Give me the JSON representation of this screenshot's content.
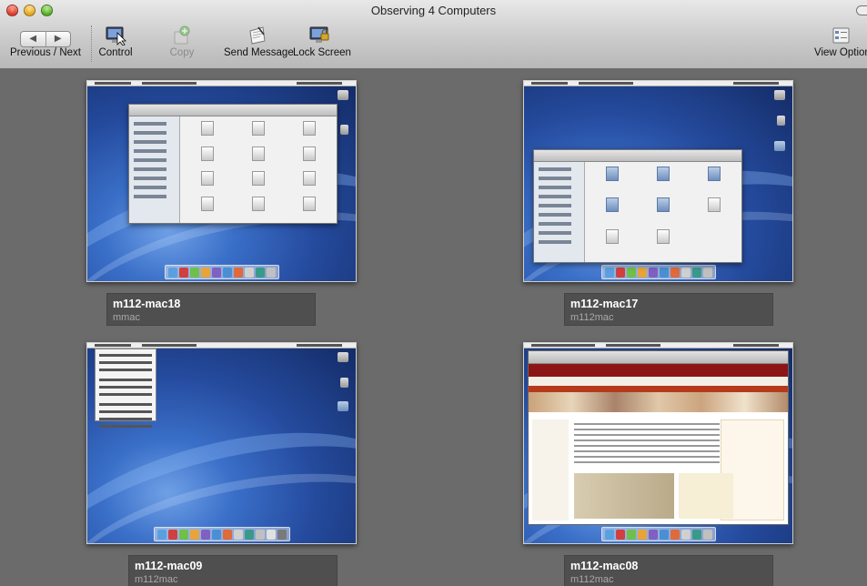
{
  "window": {
    "title": "Observing 4 Computers"
  },
  "toolbar": {
    "nav_back": "◀",
    "nav_forward": "▶",
    "items": [
      {
        "label": "Previous / Next",
        "icon": "back-forward-icon",
        "enabled": true
      },
      {
        "label": "Control",
        "icon": "control-screen-icon",
        "enabled": true
      },
      {
        "label": "Copy",
        "icon": "copy-items-icon",
        "enabled": false
      },
      {
        "label": "Send Message",
        "icon": "send-message-icon",
        "enabled": true
      },
      {
        "label": "Lock Screen",
        "icon": "lock-screen-icon",
        "enabled": true
      },
      {
        "label": "View Option",
        "icon": "view-options-icon",
        "enabled": true
      }
    ]
  },
  "computers": [
    {
      "name": "m112-mac18",
      "user": "mmac",
      "screen": "finder-desktop-files"
    },
    {
      "name": "m112-mac17",
      "user": "m112mac",
      "screen": "finder-macintosh-hd"
    },
    {
      "name": "m112-mac09",
      "user": "m112mac",
      "screen": "apple-menu-open"
    },
    {
      "name": "m112-mac08",
      "user": "m112mac",
      "screen": "safari-lane-library"
    }
  ],
  "colors": {
    "background": "#6b6b6b",
    "caption_bg": "#4f4f4f",
    "caption_name": "#ffffff",
    "caption_user": "#a9a9a9",
    "desktop_blue": "#254b9e"
  }
}
